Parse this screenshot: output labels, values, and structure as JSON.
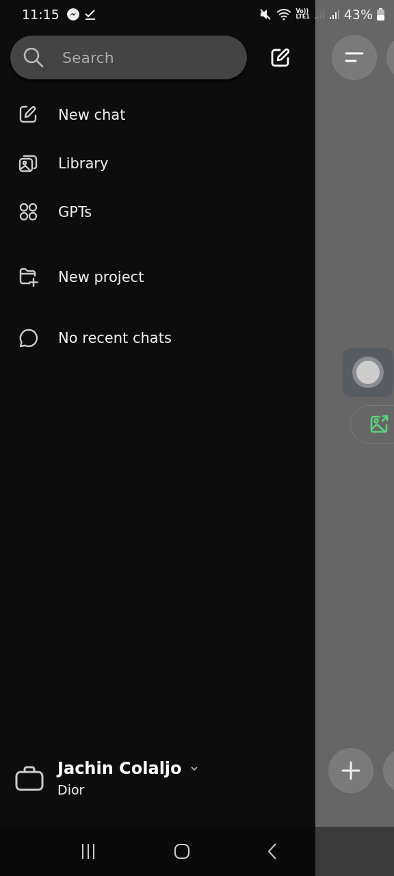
{
  "status_bar": {
    "time": "11:15",
    "network_top": "Vo))",
    "network_bottom": "LTE1",
    "battery": "43%"
  },
  "search": {
    "placeholder": "Search"
  },
  "menu": [
    {
      "label": "New chat"
    },
    {
      "label": "Library"
    },
    {
      "label": "GPTs"
    }
  ],
  "projects": [
    {
      "label": "New project"
    }
  ],
  "recent_note": "No recent chats",
  "account": {
    "name": "Jachin Colaljo",
    "workspace": "Dior"
  }
}
